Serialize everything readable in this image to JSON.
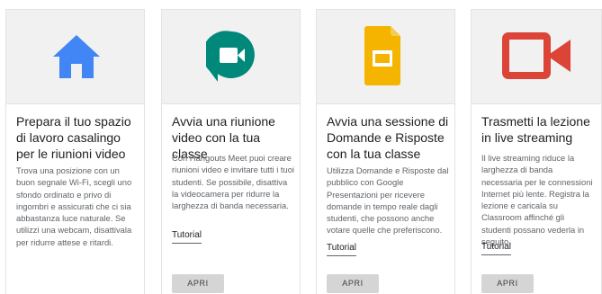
{
  "cards": [
    {
      "icon": "home-icon",
      "title": "Prepara il tuo spazio di lavoro casalingo per le riunioni video",
      "description": "Trova una posizione con un buon segnale Wi-Fi, scegli uno sfondo ordinato e privo di ingombri e assicurati che ci sia abbastanza luce naturale. Se utilizzi una webcam, disattivala per ridurre attese e ritardi.",
      "button": "APRI"
    },
    {
      "icon": "hangouts-meet-icon",
      "title": "Avvia una riunione video con la tua classe",
      "description": "Con Hangouts Meet puoi creare riunioni video e invitare tutti i tuoi studenti. Se possibile, disattiva la videocamera per ridurre la larghezza di banda necessaria.",
      "link": "Tutorial",
      "button": "APRI"
    },
    {
      "icon": "google-slides-icon",
      "title": "Avvia una sessione di Domande e Risposte con la tua classe",
      "description": "Utilizza Domande e Risposte dal pubblico con Google Presentazioni per ricevere domande in tempo reale dagli studenti, che possono anche votare quelle che preferiscono.",
      "link": "Tutorial",
      "button": "APRI"
    },
    {
      "icon": "video-camera-icon",
      "title": "Trasmetti la lezione in live streaming",
      "description": "Il live streaming riduce la larghezza di banda necessaria per le connessioni Internet più lente. Registra la lezione e caricala su Classroom affinché gli studenti possano vederla in seguito.",
      "link": "Tutorial",
      "button": "APRI"
    }
  ],
  "colors": {
    "home_blue": "#4285f4",
    "meet_green": "#00897b",
    "slides_yellow": "#f4b400",
    "camera_red": "#db4437"
  }
}
